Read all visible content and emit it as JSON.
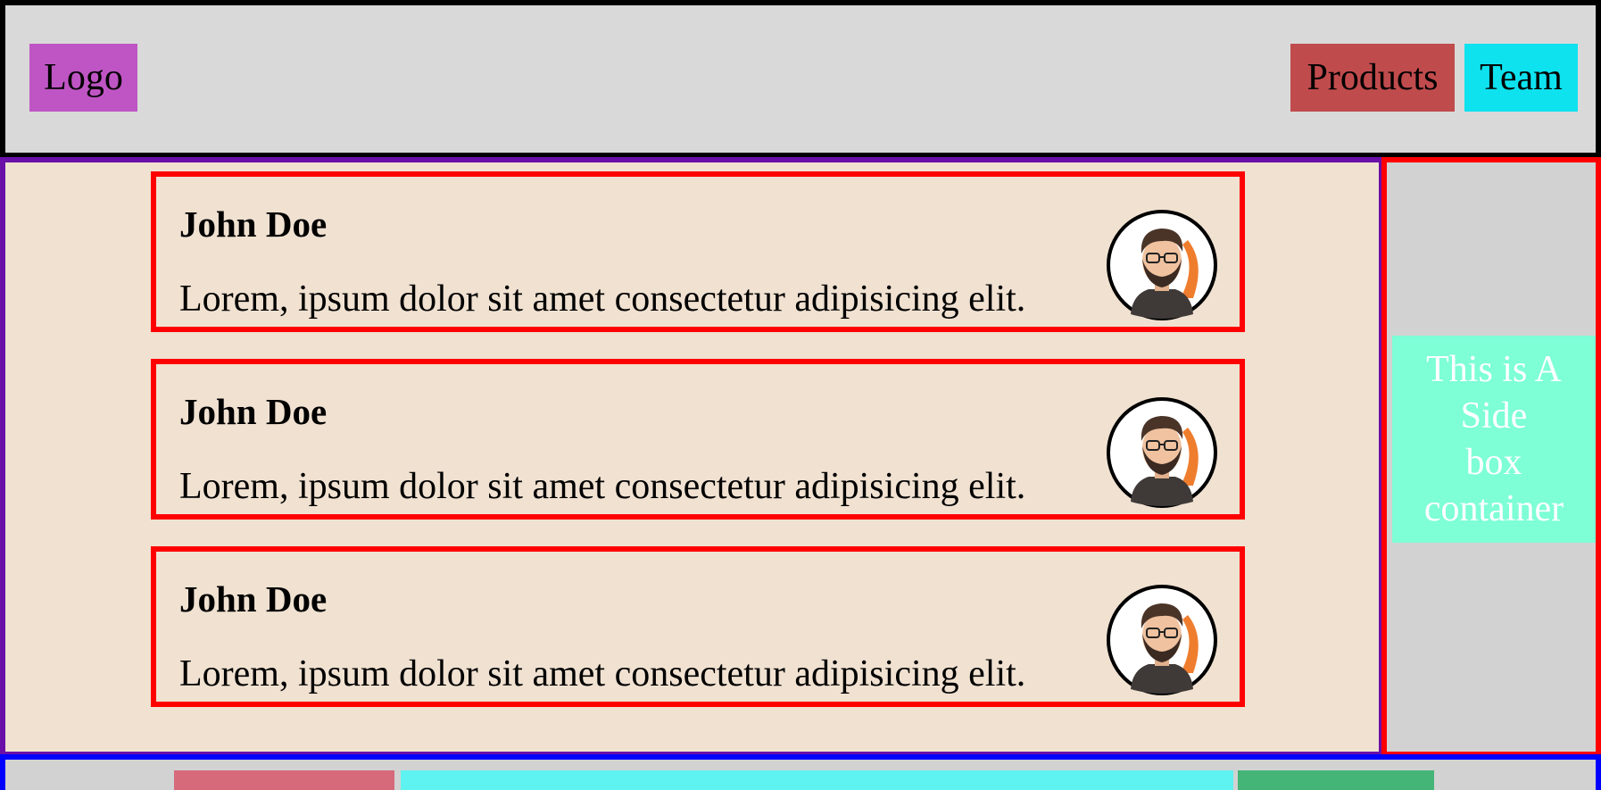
{
  "header": {
    "logo": "Logo",
    "nav": [
      "Products",
      "Team"
    ]
  },
  "cards": [
    {
      "name": "John Doe",
      "text": "Lorem, ipsum dolor sit amet consectetur adipisicing elit."
    },
    {
      "name": "John Doe",
      "text": "Lorem, ipsum dolor sit amet consectetur adipisicing elit."
    },
    {
      "name": "John Doe",
      "text": "Lorem, ipsum dolor sit amet consectetur adipisicing elit."
    }
  ],
  "sidebar": {
    "box_lines": [
      "This is A",
      "Side",
      "box",
      "container"
    ]
  },
  "colors": {
    "header_bg": "#d9d9d9",
    "logo_bg": "#bf55c4",
    "products_bg": "#c04b4d",
    "team_bg": "#0ee2ef",
    "main_bg": "#f0e1d1",
    "main_border": "#6a10a8",
    "card_border": "#ff0000",
    "sidebar_bg": "#d2d2d2",
    "side_box_bg": "#7effd6",
    "footer_border": "#0000ff",
    "footer_blocks": [
      "#d66a7b",
      "#5ef2f0",
      "#44b577"
    ]
  },
  "icons": {
    "avatar": "avatar-icon"
  }
}
